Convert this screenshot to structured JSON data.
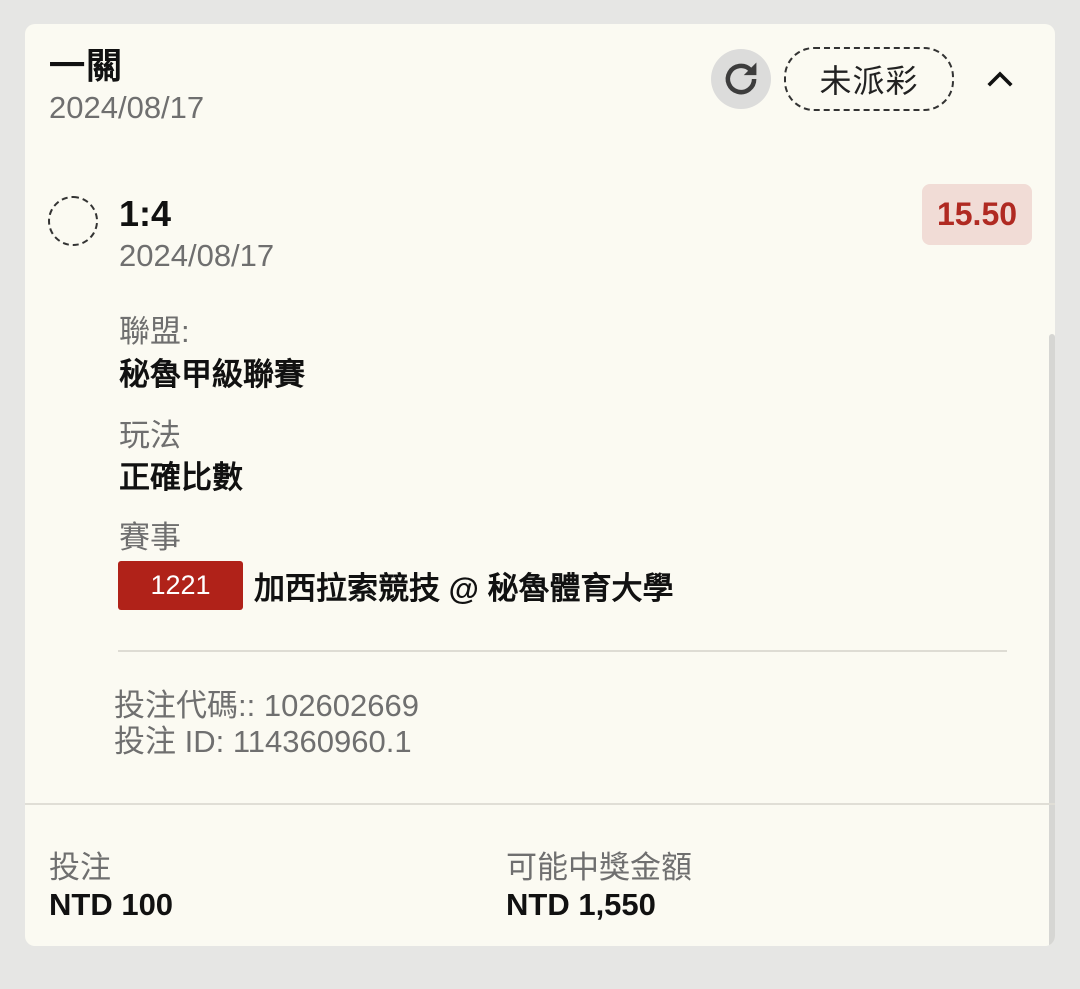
{
  "header": {
    "title": "一關",
    "date": "2024/08/17",
    "status": "未派彩",
    "icons": {
      "refresh": "refresh-icon",
      "collapse": "chevron-up-icon"
    }
  },
  "selection": {
    "score": "1:4",
    "date": "2024/08/17",
    "odds": "15.50",
    "radio_icon": "dashed-circle-icon"
  },
  "details": {
    "league_label": "聯盟:",
    "league_value": "秘魯甲級聯賽",
    "market_label": "玩法",
    "market_value": "正確比數",
    "match_label": "賽事",
    "match_code": "1221",
    "match_name": "加西拉索競技 @ 秘魯體育大學"
  },
  "bet_info": {
    "bet_code": "投注代碼:: 102602669",
    "bet_id": "投注 ID: 114360960.1"
  },
  "footer": {
    "stake_label": "投注",
    "stake_value": "NTD 100",
    "payout_label": "可能中獎金額",
    "payout_value": "NTD 1,550"
  },
  "colors": {
    "card_bg": "#fbfaf2",
    "page_bg": "#e6e6e4",
    "accent_red": "#b02219",
    "odds_bg": "#f1dcd6",
    "muted_text": "#6f6f6f"
  }
}
